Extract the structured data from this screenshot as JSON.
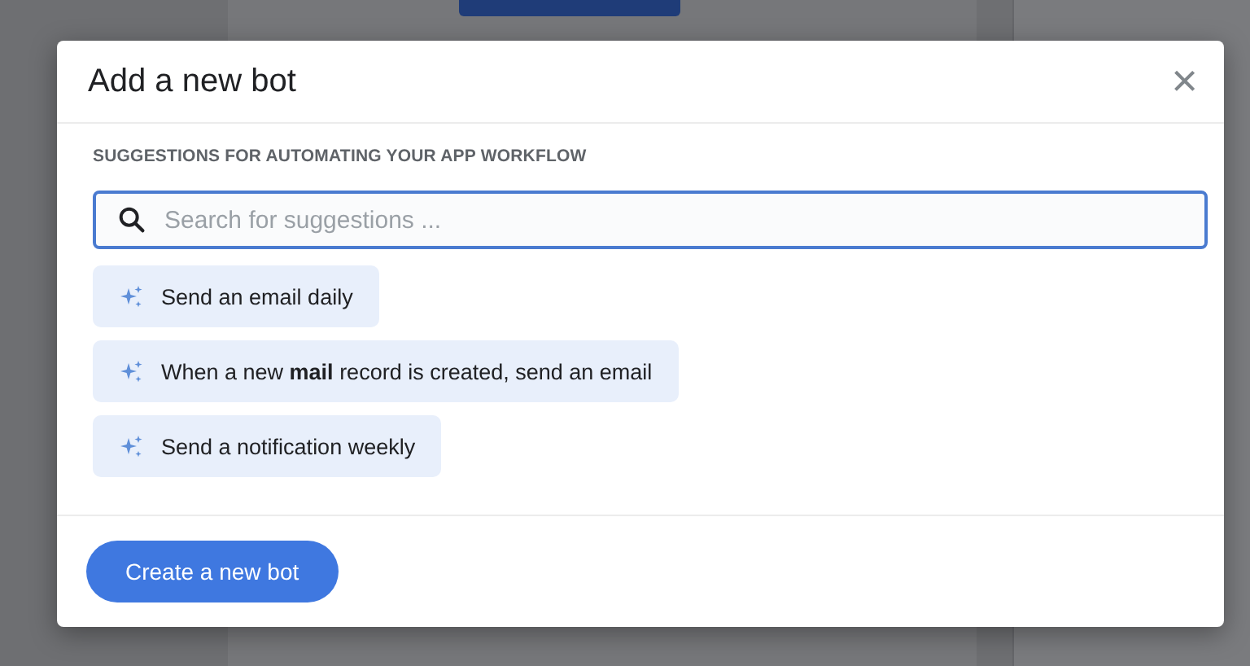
{
  "dialog": {
    "title": "Add a new bot",
    "close_icon": "×",
    "section_label": "SUGGESTIONS FOR AUTOMATING YOUR APP WORKFLOW",
    "search": {
      "placeholder": "Search for suggestions ..."
    },
    "suggestions": [
      {
        "label": "Send an email daily"
      },
      {
        "label": "When a new **mail** record is created, send an email"
      },
      {
        "label": "Send a notification weekly"
      }
    ],
    "primary_button": "Create a new bot"
  }
}
